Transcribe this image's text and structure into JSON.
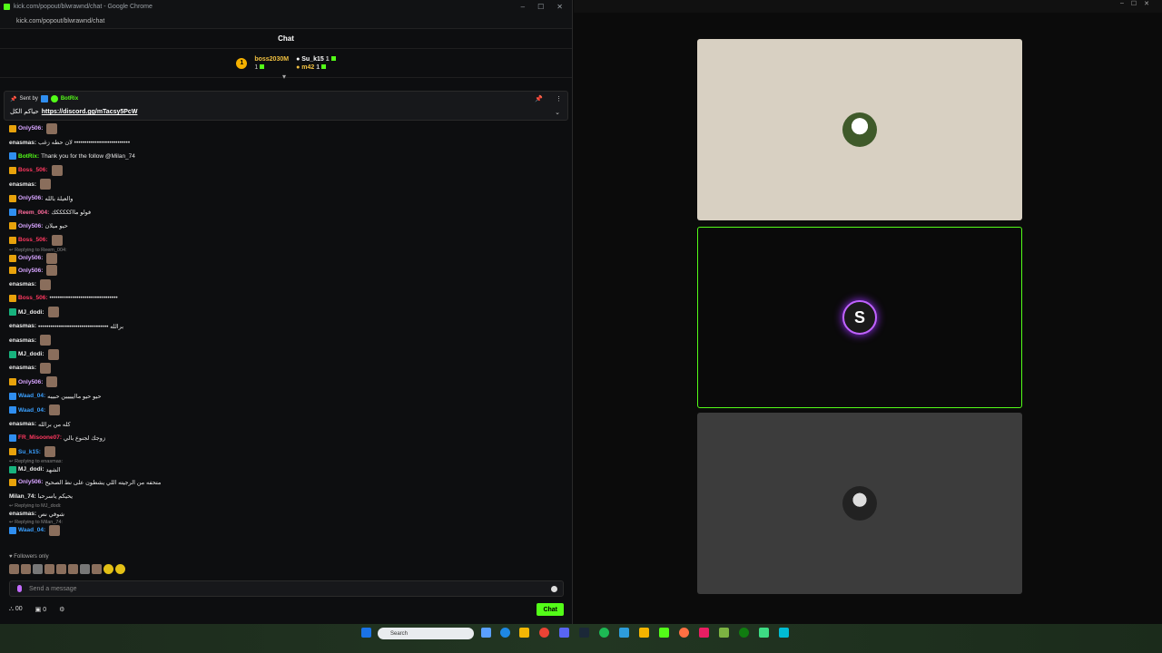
{
  "window": {
    "title": "kick.com/popout/blwrawnd/chat - Google Chrome",
    "address": "kick.com/popout/blwrawnd/chat"
  },
  "chat": {
    "header": "Chat",
    "leaderboard": [
      {
        "rank": "1",
        "name": "boss2030M",
        "count": "1"
      },
      {
        "name": "Su_k15",
        "count": "1"
      },
      {
        "name": "m42",
        "count": "1"
      }
    ],
    "pinned": {
      "sent_by": "Sent by",
      "bot": "BotRix",
      "prefix": "حياكم الكل",
      "link": "https://discord.gg/mTacsy5PcW"
    },
    "messages": [
      {
        "user": "Only506",
        "color": "#d7a4ff",
        "text": "",
        "badge": "crown"
      },
      {
        "user": "enasmas",
        "color": "#eeeeee",
        "text": "لان حطه زغب •••••••••••••••••••••••••••"
      },
      {
        "user": "BotRix",
        "color": "#53fc18",
        "text": "Thank you for the follow @Milan_74",
        "badge": "mod"
      },
      {
        "user": "Boss_506",
        "color": "#ff3860",
        "text": "",
        "badge": "crown"
      },
      {
        "user": "enasmas",
        "color": "#eeeeee",
        "text": ""
      },
      {
        "user": "Only506",
        "color": "#d7a4ff",
        "text": "والعيلة بالله",
        "badge": "crown"
      },
      {
        "user": "Reem_004",
        "color": "#ff6b9d",
        "text": "فولو مااكككككك",
        "badge": "mod"
      },
      {
        "user": "Only506",
        "color": "#d7a4ff",
        "text": "حيو ميلان",
        "badge": "crown"
      },
      {
        "user": "Boss_506",
        "color": "#ff3860",
        "text": "",
        "badge": "crown"
      },
      {
        "reply": "Replying to Reem_004:",
        "user": "Only506",
        "color": "#d7a4ff",
        "text": "",
        "badge": "crown"
      },
      {
        "user": "Only506",
        "color": "#d7a4ff",
        "text": "",
        "badge": "crown"
      },
      {
        "user": "enasmas",
        "color": "#eeeeee",
        "text": ""
      },
      {
        "user": "Boss_506",
        "color": "#ff3860",
        "text": "•••••••••••••••••••••••••••••••••",
        "badge": "crown"
      },
      {
        "user": "MJ_dodi",
        "color": "#eeeeee",
        "text": "",
        "badge": "ver"
      },
      {
        "user": "enasmas",
        "color": "#eeeeee",
        "text": "•••••••••••••••••••••••••••••••••• برالله"
      },
      {
        "user": "enasmas",
        "color": "#eeeeee",
        "text": ""
      },
      {
        "user": "MJ_dodi",
        "color": "#eeeeee",
        "text": "",
        "badge": "ver"
      },
      {
        "user": "enasmas",
        "color": "#eeeeee",
        "text": ""
      },
      {
        "user": "Only506",
        "color": "#d7a4ff",
        "text": "",
        "badge": "crown"
      },
      {
        "user": "Waad_04",
        "color": "#3aa0ff",
        "text": "حيو حيو مااييييين حبيبه",
        "badge": "mod"
      },
      {
        "user": "Waad_04",
        "color": "#3aa0ff",
        "text": "",
        "badge": "mod"
      },
      {
        "user": "enasmas",
        "color": "#eeeeee",
        "text": "كله من برالله"
      },
      {
        "user": "FR_Misoone07",
        "color": "#ff3860",
        "text": "زوجك لجنوع بالي",
        "badge": "mod"
      },
      {
        "user": "Su_k15",
        "color": "#3aa0ff",
        "text": "",
        "badge": "crown"
      },
      {
        "reply": "Replying to enasmas:",
        "user": "MJ_dodi",
        "color": "#eeeeee",
        "text": "الشهد",
        "badge": "ver"
      },
      {
        "user": "Only506",
        "color": "#d7a4ff",
        "text": "متحفه من الرجيته اللي يشطون على نط الصحيح",
        "badge": "crown"
      },
      {
        "user": "Milan_74",
        "color": "#eeeeee",
        "text": "يحيكم ياسرحبا"
      },
      {
        "reply": "Replying to MJ_dodi:",
        "user": "enasmas",
        "color": "#eeeeee",
        "text": "شوفي نص"
      },
      {
        "reply": "Replying to Milan_74:",
        "user": "Waad_04",
        "color": "#3aa0ff",
        "text": "",
        "badge": "mod"
      }
    ],
    "followers_only": "Followers only",
    "input_placeholder": "Send a message",
    "viewers": "00",
    "points": "0",
    "send_label": "Chat"
  },
  "taskbar": {
    "search_placeholder": "Search"
  },
  "colors": {
    "accent": "#53fc18",
    "background": "#0d0e10"
  }
}
